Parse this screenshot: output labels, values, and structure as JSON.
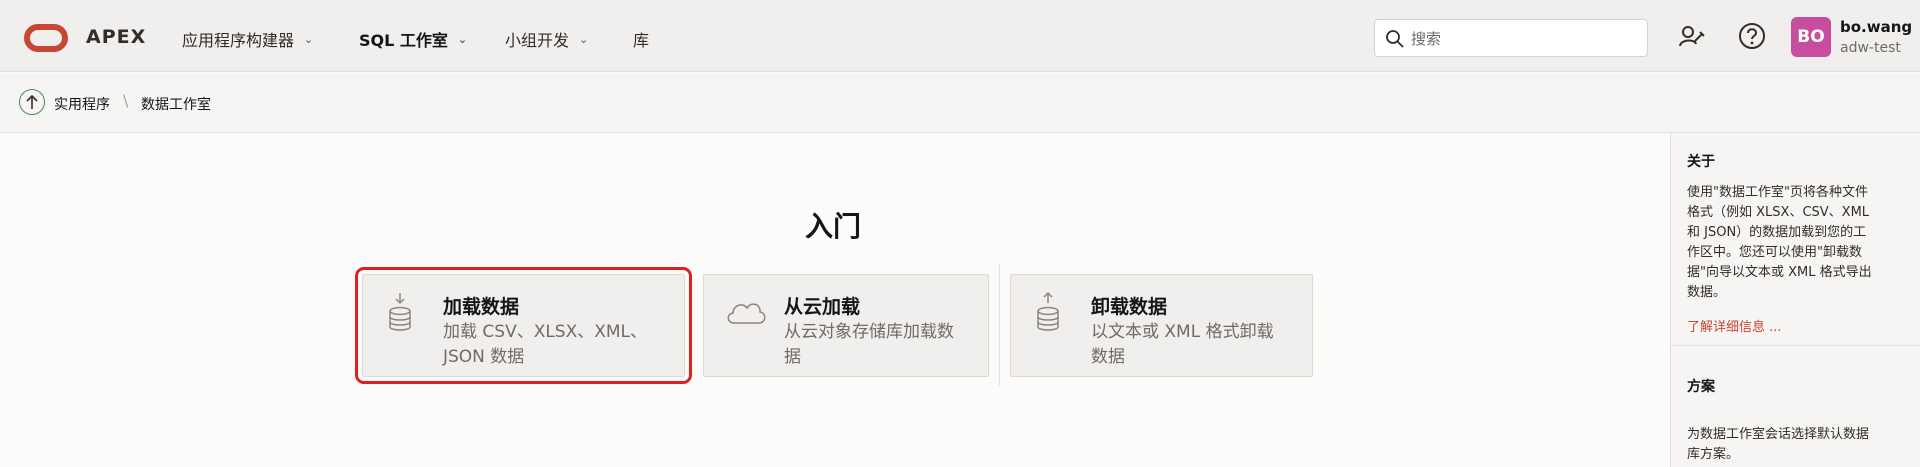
{
  "header": {
    "logo_text": "APEX",
    "nav": [
      {
        "label": "应用程序构建器"
      },
      {
        "label": "SQL 工作室"
      },
      {
        "label": "小组开发"
      },
      {
        "label": "库"
      }
    ],
    "search_placeholder": "搜索",
    "user": {
      "initials": "BO",
      "name": "bo.wang",
      "workspace": "adw-test"
    }
  },
  "breadcrumb": {
    "items": [
      "实用程序",
      "数据工作室"
    ],
    "separator": "\\"
  },
  "main": {
    "title": "入门",
    "cards": [
      {
        "title": "加载数据",
        "desc_lines": [
          "加载 CSV、XLSX、XML、",
          "JSON 数据"
        ],
        "icon": "database-download-icon"
      },
      {
        "title": "从云加载",
        "desc_lines": [
          "从云对象存储库加载数",
          "据"
        ],
        "icon": "cloud-icon"
      },
      {
        "title": "卸载数据",
        "desc_lines": [
          "以文本或 XML 格式卸载",
          "数据"
        ],
        "icon": "database-upload-icon"
      }
    ]
  },
  "sidebar": {
    "about_title": "关于",
    "about_lines": [
      "使用\"数据工作室\"页将各种文件",
      "格式（例如 XLSX、CSV、XML",
      "和 JSON）的数据加载到您的工",
      "作区中。您还可以使用\"卸载数",
      "据\"向导以文本或 XML 格式导出",
      "数据。"
    ],
    "learn_more": "了解详细信息 ...",
    "schema_title": "方案",
    "schema_lines": [
      "为数据工作室会话选择默认数据",
      "库方案。"
    ]
  },
  "colors": {
    "accent": "#c74634",
    "avatar": "#c74d9e",
    "selected_outline": "#e0201e"
  }
}
